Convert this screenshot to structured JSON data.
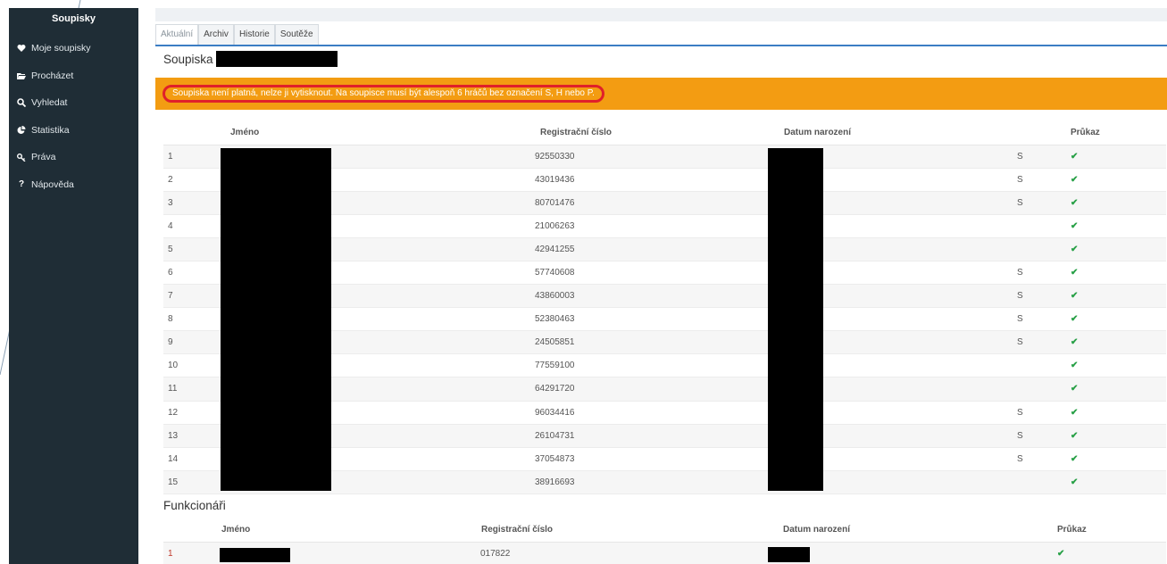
{
  "sidebar": {
    "brand": "Soupisky",
    "items": [
      {
        "icon": "heart-icon",
        "label": "Moje soupisky"
      },
      {
        "icon": "folder-open-icon",
        "label": "Procházet"
      },
      {
        "icon": "search-icon",
        "label": "Vyhledat"
      },
      {
        "icon": "pie-chart-icon",
        "label": "Statistika"
      },
      {
        "icon": "key-icon",
        "label": "Práva"
      },
      {
        "icon": "question-icon",
        "label": "Nápověda"
      }
    ]
  },
  "tabs": [
    "Aktuální",
    "Archiv",
    "Historie",
    "Soutěže"
  ],
  "roster": {
    "title": "Soupiska",
    "alert": "Soupiska není platná, nelze ji vytisknout. Na soupisce musí být alespoň 6 hráčů bez označení S, H nebo P.",
    "columns": {
      "name": "Jméno",
      "reg": "Registrační číslo",
      "dob": "Datum narození",
      "card": "Průkaz"
    },
    "rows": [
      {
        "num": "1",
        "reg": "92550330",
        "flag": "S",
        "card": "✔"
      },
      {
        "num": "2",
        "reg": "43019436",
        "flag": "S",
        "card": "✔"
      },
      {
        "num": "3",
        "reg": "80701476",
        "flag": "S",
        "card": "✔"
      },
      {
        "num": "4",
        "reg": "21006263",
        "flag": "",
        "card": "✔"
      },
      {
        "num": "5",
        "reg": "42941255",
        "flag": "",
        "card": "✔"
      },
      {
        "num": "6",
        "reg": "57740608",
        "flag": "S",
        "card": "✔"
      },
      {
        "num": "7",
        "reg": "43860003",
        "flag": "S",
        "card": "✔"
      },
      {
        "num": "8",
        "reg": "52380463",
        "flag": "S",
        "card": "✔"
      },
      {
        "num": "9",
        "reg": "24505851",
        "flag": "S",
        "card": "✔"
      },
      {
        "num": "10",
        "reg": "77559100",
        "flag": "",
        "card": "✔"
      },
      {
        "num": "11",
        "reg": "64291720",
        "flag": "",
        "card": "✔"
      },
      {
        "num": "12",
        "reg": "96034416",
        "flag": "S",
        "card": "✔"
      },
      {
        "num": "13",
        "reg": "26104731",
        "flag": "S",
        "card": "✔"
      },
      {
        "num": "14",
        "reg": "37054873",
        "flag": "S",
        "card": "✔"
      },
      {
        "num": "15",
        "reg": "38916693",
        "flag": "",
        "card": "✔"
      }
    ]
  },
  "officials": {
    "title": "Funkcionáři",
    "columns": {
      "name": "Jméno",
      "reg": "Registrační číslo",
      "dob": "Datum narození",
      "card": "Průkaz"
    },
    "rows": [
      {
        "num": "1",
        "reg": "017822",
        "flag": "",
        "card": "✔"
      }
    ]
  },
  "colors": {
    "sidebar_bg": "#1f2d36",
    "alert_bg": "#f39c12",
    "alert_outline": "#e0202a",
    "tab_rule": "#3b7dc4",
    "check": "#27a046"
  }
}
